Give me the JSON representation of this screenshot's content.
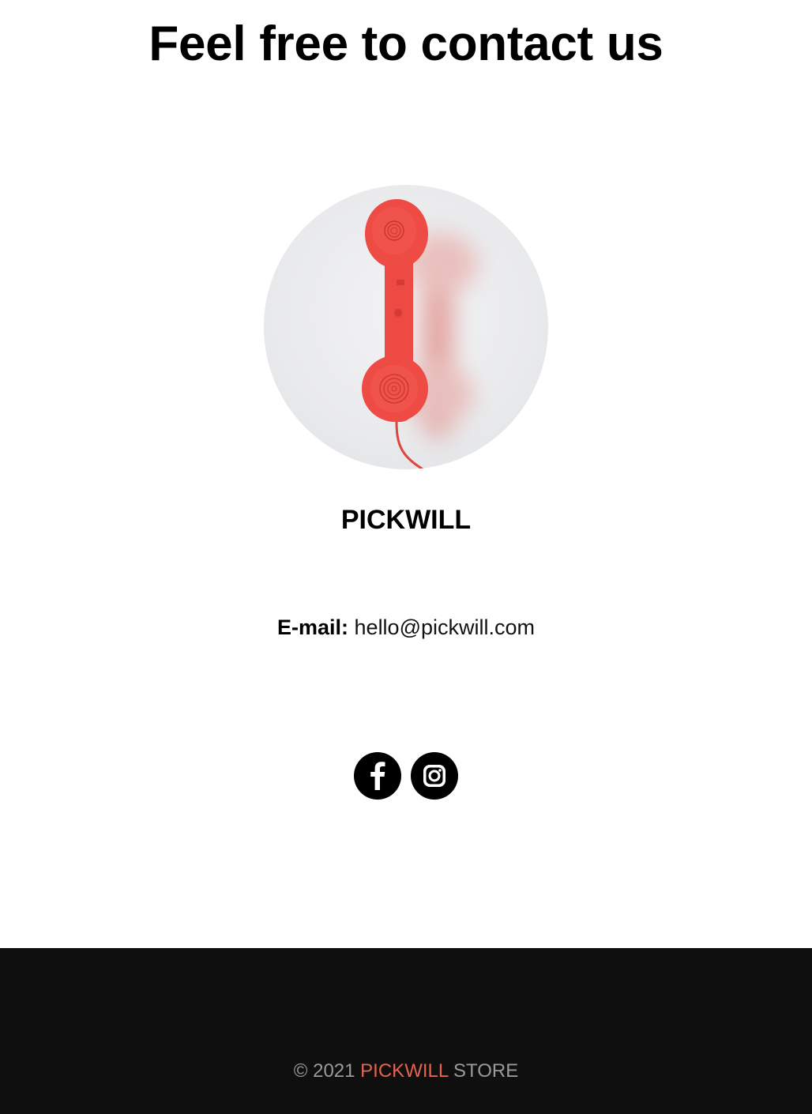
{
  "page": {
    "title": "Feel free to contact us"
  },
  "contact": {
    "photo_icon": "red-telephone-handset-photo",
    "name": "PICKWILL",
    "email_label": "E-mail:",
    "email_value": "hello@pickwill.com"
  },
  "socials": [
    {
      "name": "facebook",
      "icon": "facebook-icon"
    },
    {
      "name": "instagram",
      "icon": "instagram-icon"
    }
  ],
  "footer": {
    "copyright_prefix": "© 2021",
    "brand": "PICKWILL",
    "suffix": "STORE"
  },
  "colors": {
    "footer_bg": "#0f0f0f",
    "brand_accent": "#e5644f",
    "footer_text": "#9a9a9a",
    "handset_red": "#ef4b45"
  }
}
